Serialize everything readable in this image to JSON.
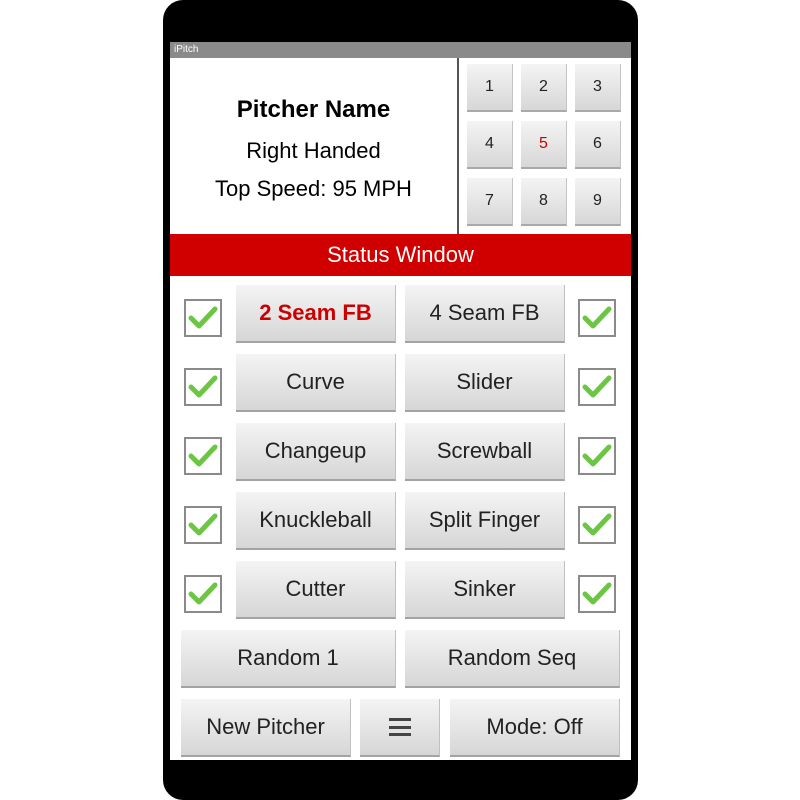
{
  "app": {
    "title": "iPitch"
  },
  "pitcher": {
    "name": "Pitcher Name",
    "hand": "Right Handed",
    "top_speed": "Top Speed: 95 MPH"
  },
  "keypad": {
    "keys": [
      "1",
      "2",
      "3",
      "4",
      "5",
      "6",
      "7",
      "8",
      "9"
    ],
    "selected": "5"
  },
  "status": {
    "label": "Status Window"
  },
  "pitches": [
    {
      "label": "2 Seam FB",
      "checked": true,
      "selected": true
    },
    {
      "label": "4 Seam FB",
      "checked": true,
      "selected": false
    },
    {
      "label": "Curve",
      "checked": true,
      "selected": false
    },
    {
      "label": "Slider",
      "checked": true,
      "selected": false
    },
    {
      "label": "Changeup",
      "checked": true,
      "selected": false
    },
    {
      "label": "Screwball",
      "checked": true,
      "selected": false
    },
    {
      "label": "Knuckleball",
      "checked": true,
      "selected": false
    },
    {
      "label": "Split Finger",
      "checked": true,
      "selected": false
    },
    {
      "label": "Cutter",
      "checked": true,
      "selected": false
    },
    {
      "label": "Sinker",
      "checked": true,
      "selected": false
    }
  ],
  "random": {
    "random1_label": "Random 1",
    "random_seq_label": "Random Seq"
  },
  "bottom": {
    "new_pitcher_label": "New Pitcher",
    "menu_icon": "menu-icon",
    "mode_label": "Mode: Off"
  },
  "colors": {
    "accent": "#d00000",
    "check": "#6cc644"
  }
}
